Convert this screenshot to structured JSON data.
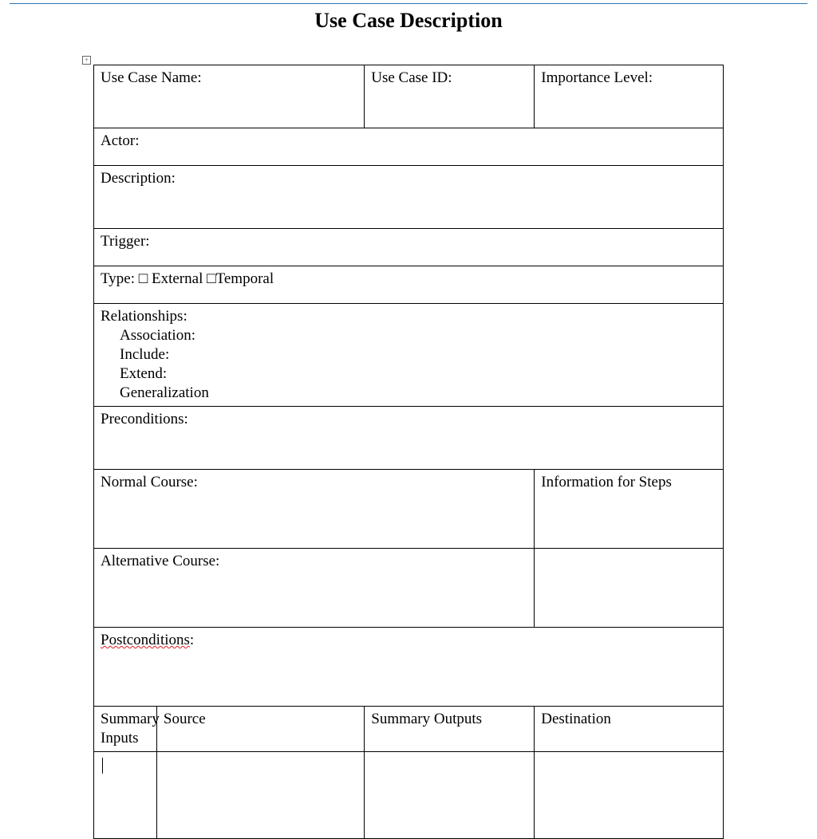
{
  "title": "Use Case Description",
  "fields": {
    "useCaseName": "Use Case Name:",
    "useCaseId": "Use Case ID:",
    "importanceLevel": "Importance Level:",
    "actor": "Actor:",
    "description": "Description:",
    "trigger": "Trigger:",
    "typeLabel": "Type: ",
    "typeExternal": "External",
    "typeTemporal": "Temporal",
    "relationships": "Relationships:",
    "association": "Association:",
    "include": "Include:",
    "extend": "Extend:",
    "generalization": "Generalization",
    "preconditions": "Preconditions:",
    "normalCourse": "Normal Course:",
    "infoForSteps": "Information for Steps",
    "alternativeCourse": "Alternative Course:",
    "postconditions": "Postconditions",
    "postconditionsColon": ":",
    "summaryInputs": "Summary Inputs",
    "source": "Source",
    "summaryOutputs": "Summary Outputs",
    "destination": "Destination"
  },
  "glyphs": {
    "checkboxEmpty": "□",
    "cornerPlus": "+"
  }
}
